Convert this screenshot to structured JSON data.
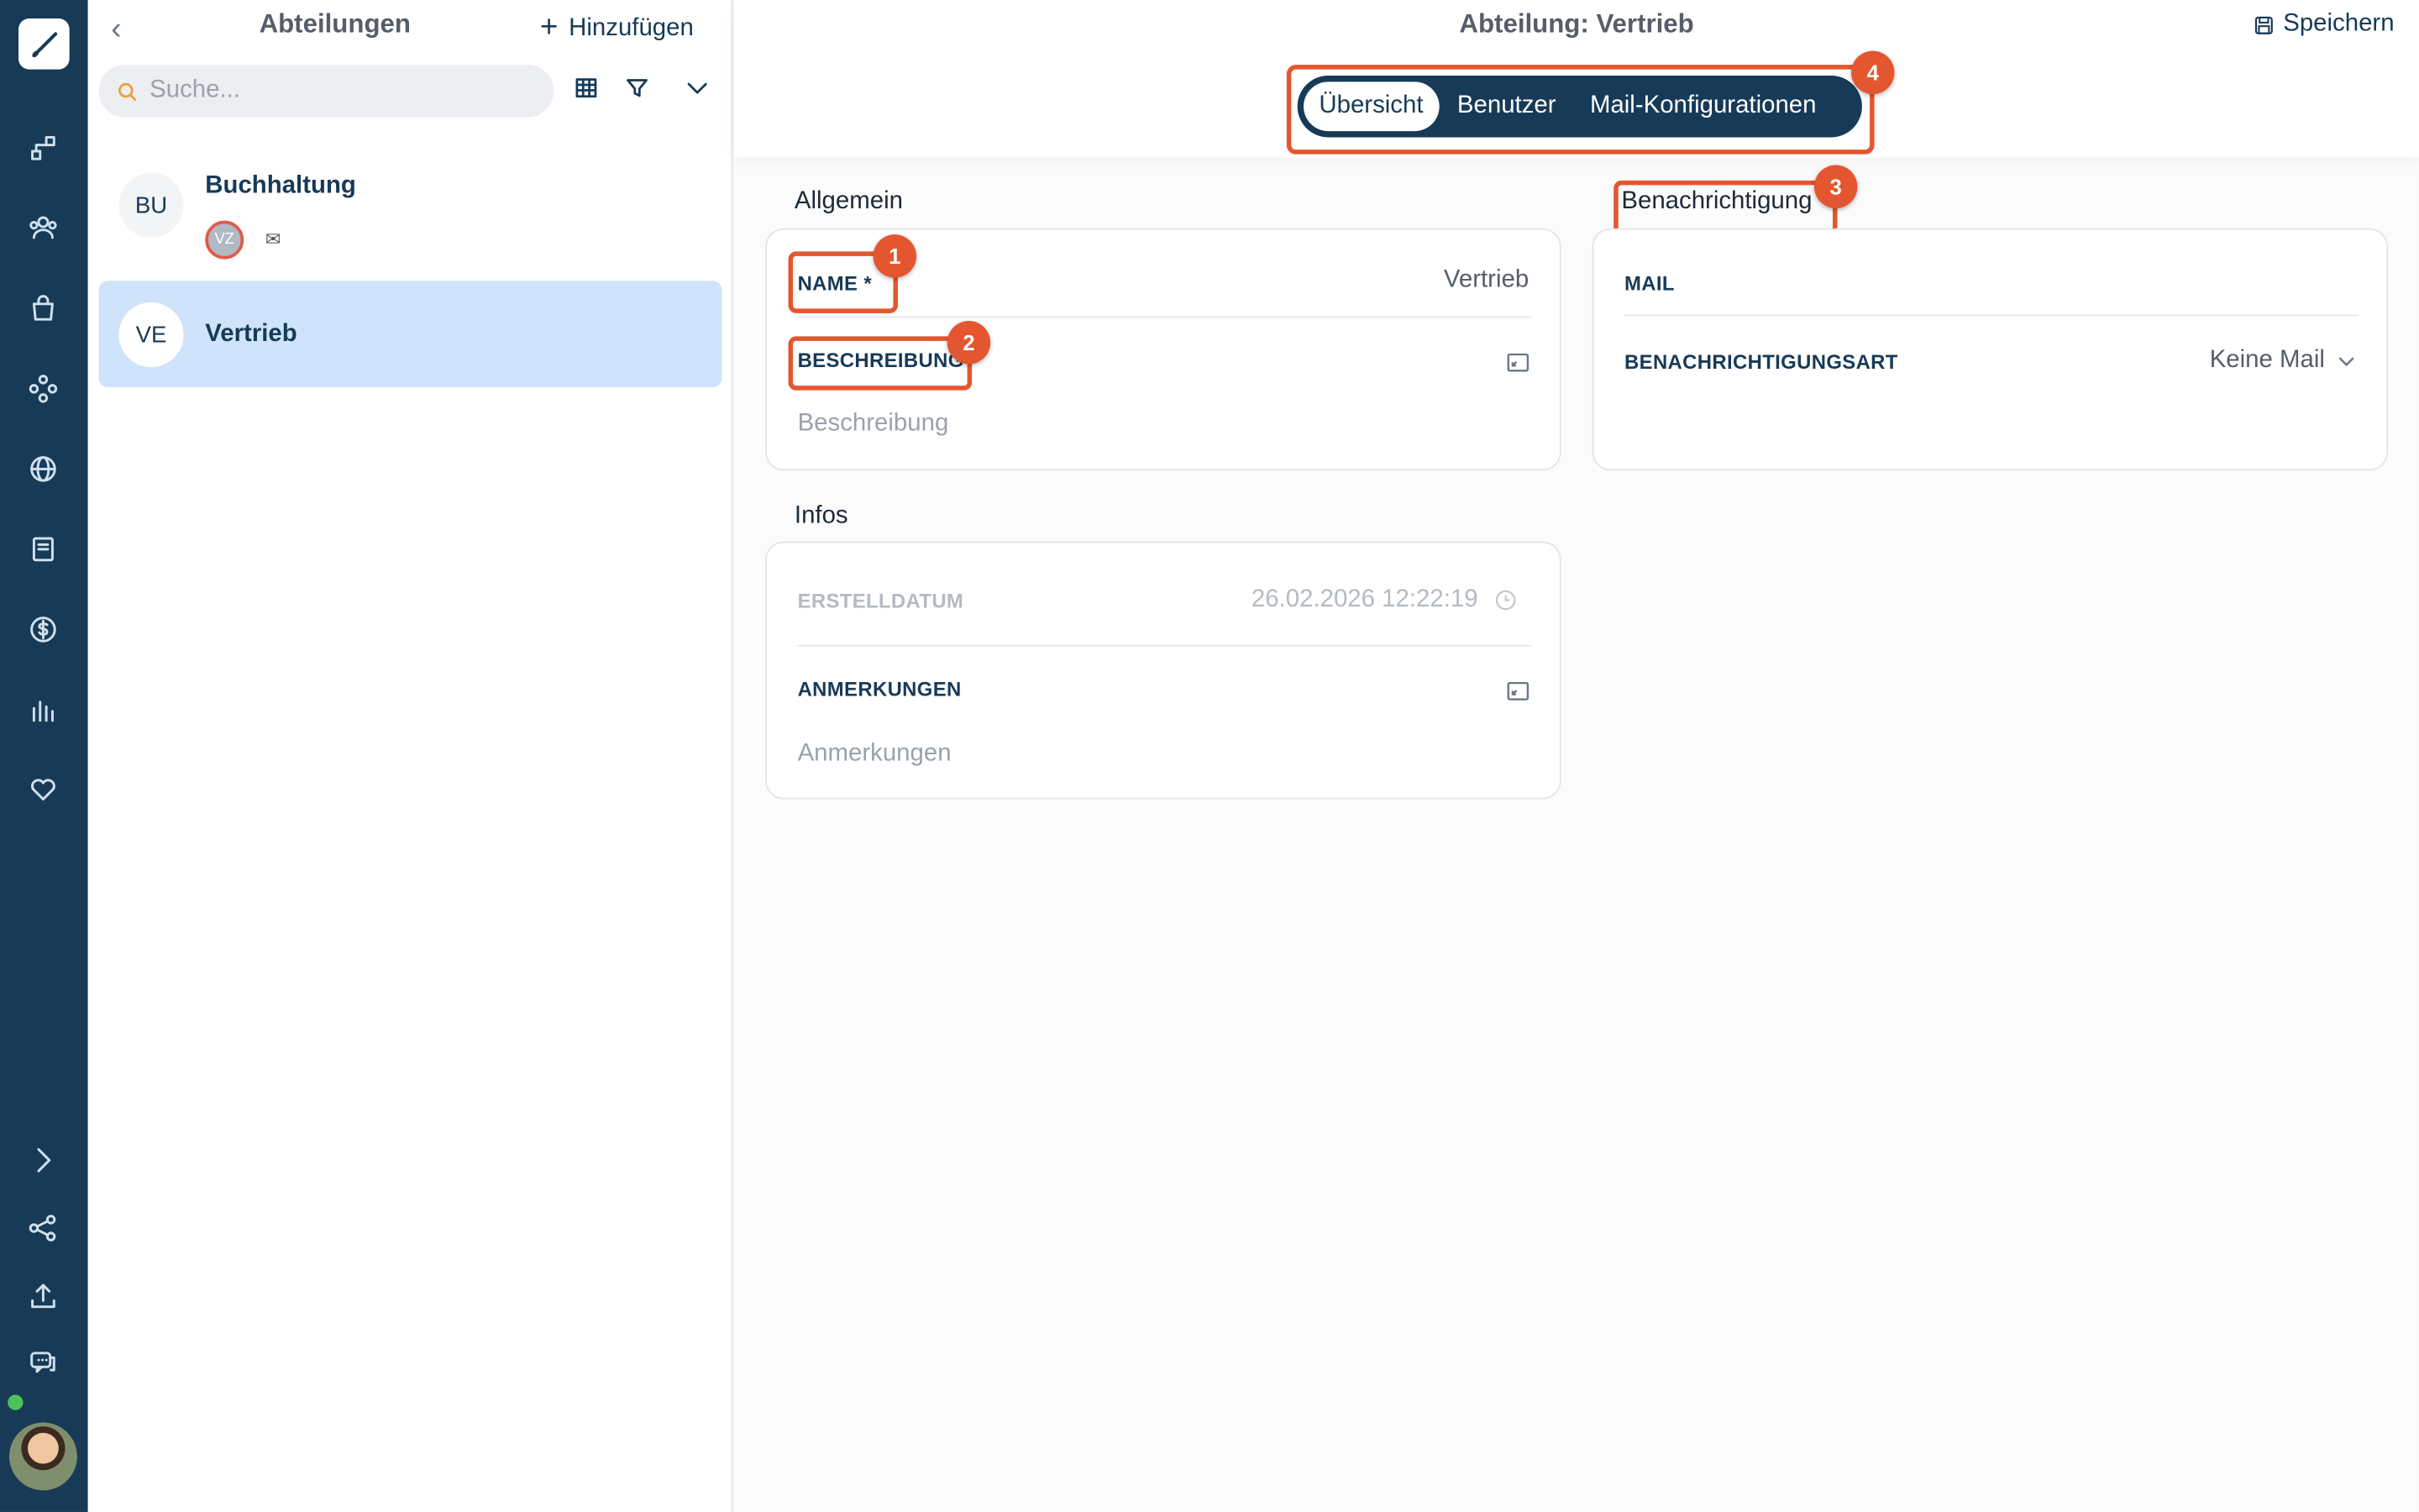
{
  "list": {
    "title": "Abteilungen",
    "add_label": "Hinzufügen",
    "search_placeholder": "Suche...",
    "items": [
      {
        "initials": "BU",
        "name": "Buchhaltung",
        "user_initials": "VZ"
      },
      {
        "initials": "VE",
        "name": "Vertrieb"
      }
    ]
  },
  "header": {
    "title": "Abteilung: Vertrieb",
    "save_label": "Speichern",
    "tabs": [
      {
        "label": "Übersicht"
      },
      {
        "label": "Benutzer"
      },
      {
        "label": "Mail-Konfigurationen"
      }
    ]
  },
  "allgemein": {
    "title": "Allgemein",
    "name_label": "NAME *",
    "name_value": "Vertrieb",
    "beschreibung_label": "BESCHREIBUNG",
    "beschreibung_placeholder": "Beschreibung"
  },
  "benachrichtigung": {
    "title": "Benachrichtigung",
    "mail_label": "MAIL",
    "art_label": "BENACHRICHTIGUNGSART",
    "art_value": "Keine Mail"
  },
  "infos": {
    "title": "Infos",
    "erstelldatum_label": "ERSTELLDATUM",
    "erstelldatum_value": "26.02.2026 12:22:19",
    "anmerkungen_label": "ANMERKUNGEN",
    "anmerkungen_placeholder": "Anmerkungen"
  },
  "badges": [
    "1",
    "2",
    "3",
    "4"
  ],
  "colors": {
    "rail": "#173a57",
    "accent": "#173a57",
    "highlight": "#e4562f",
    "selected_row": "#cfe4fa"
  }
}
